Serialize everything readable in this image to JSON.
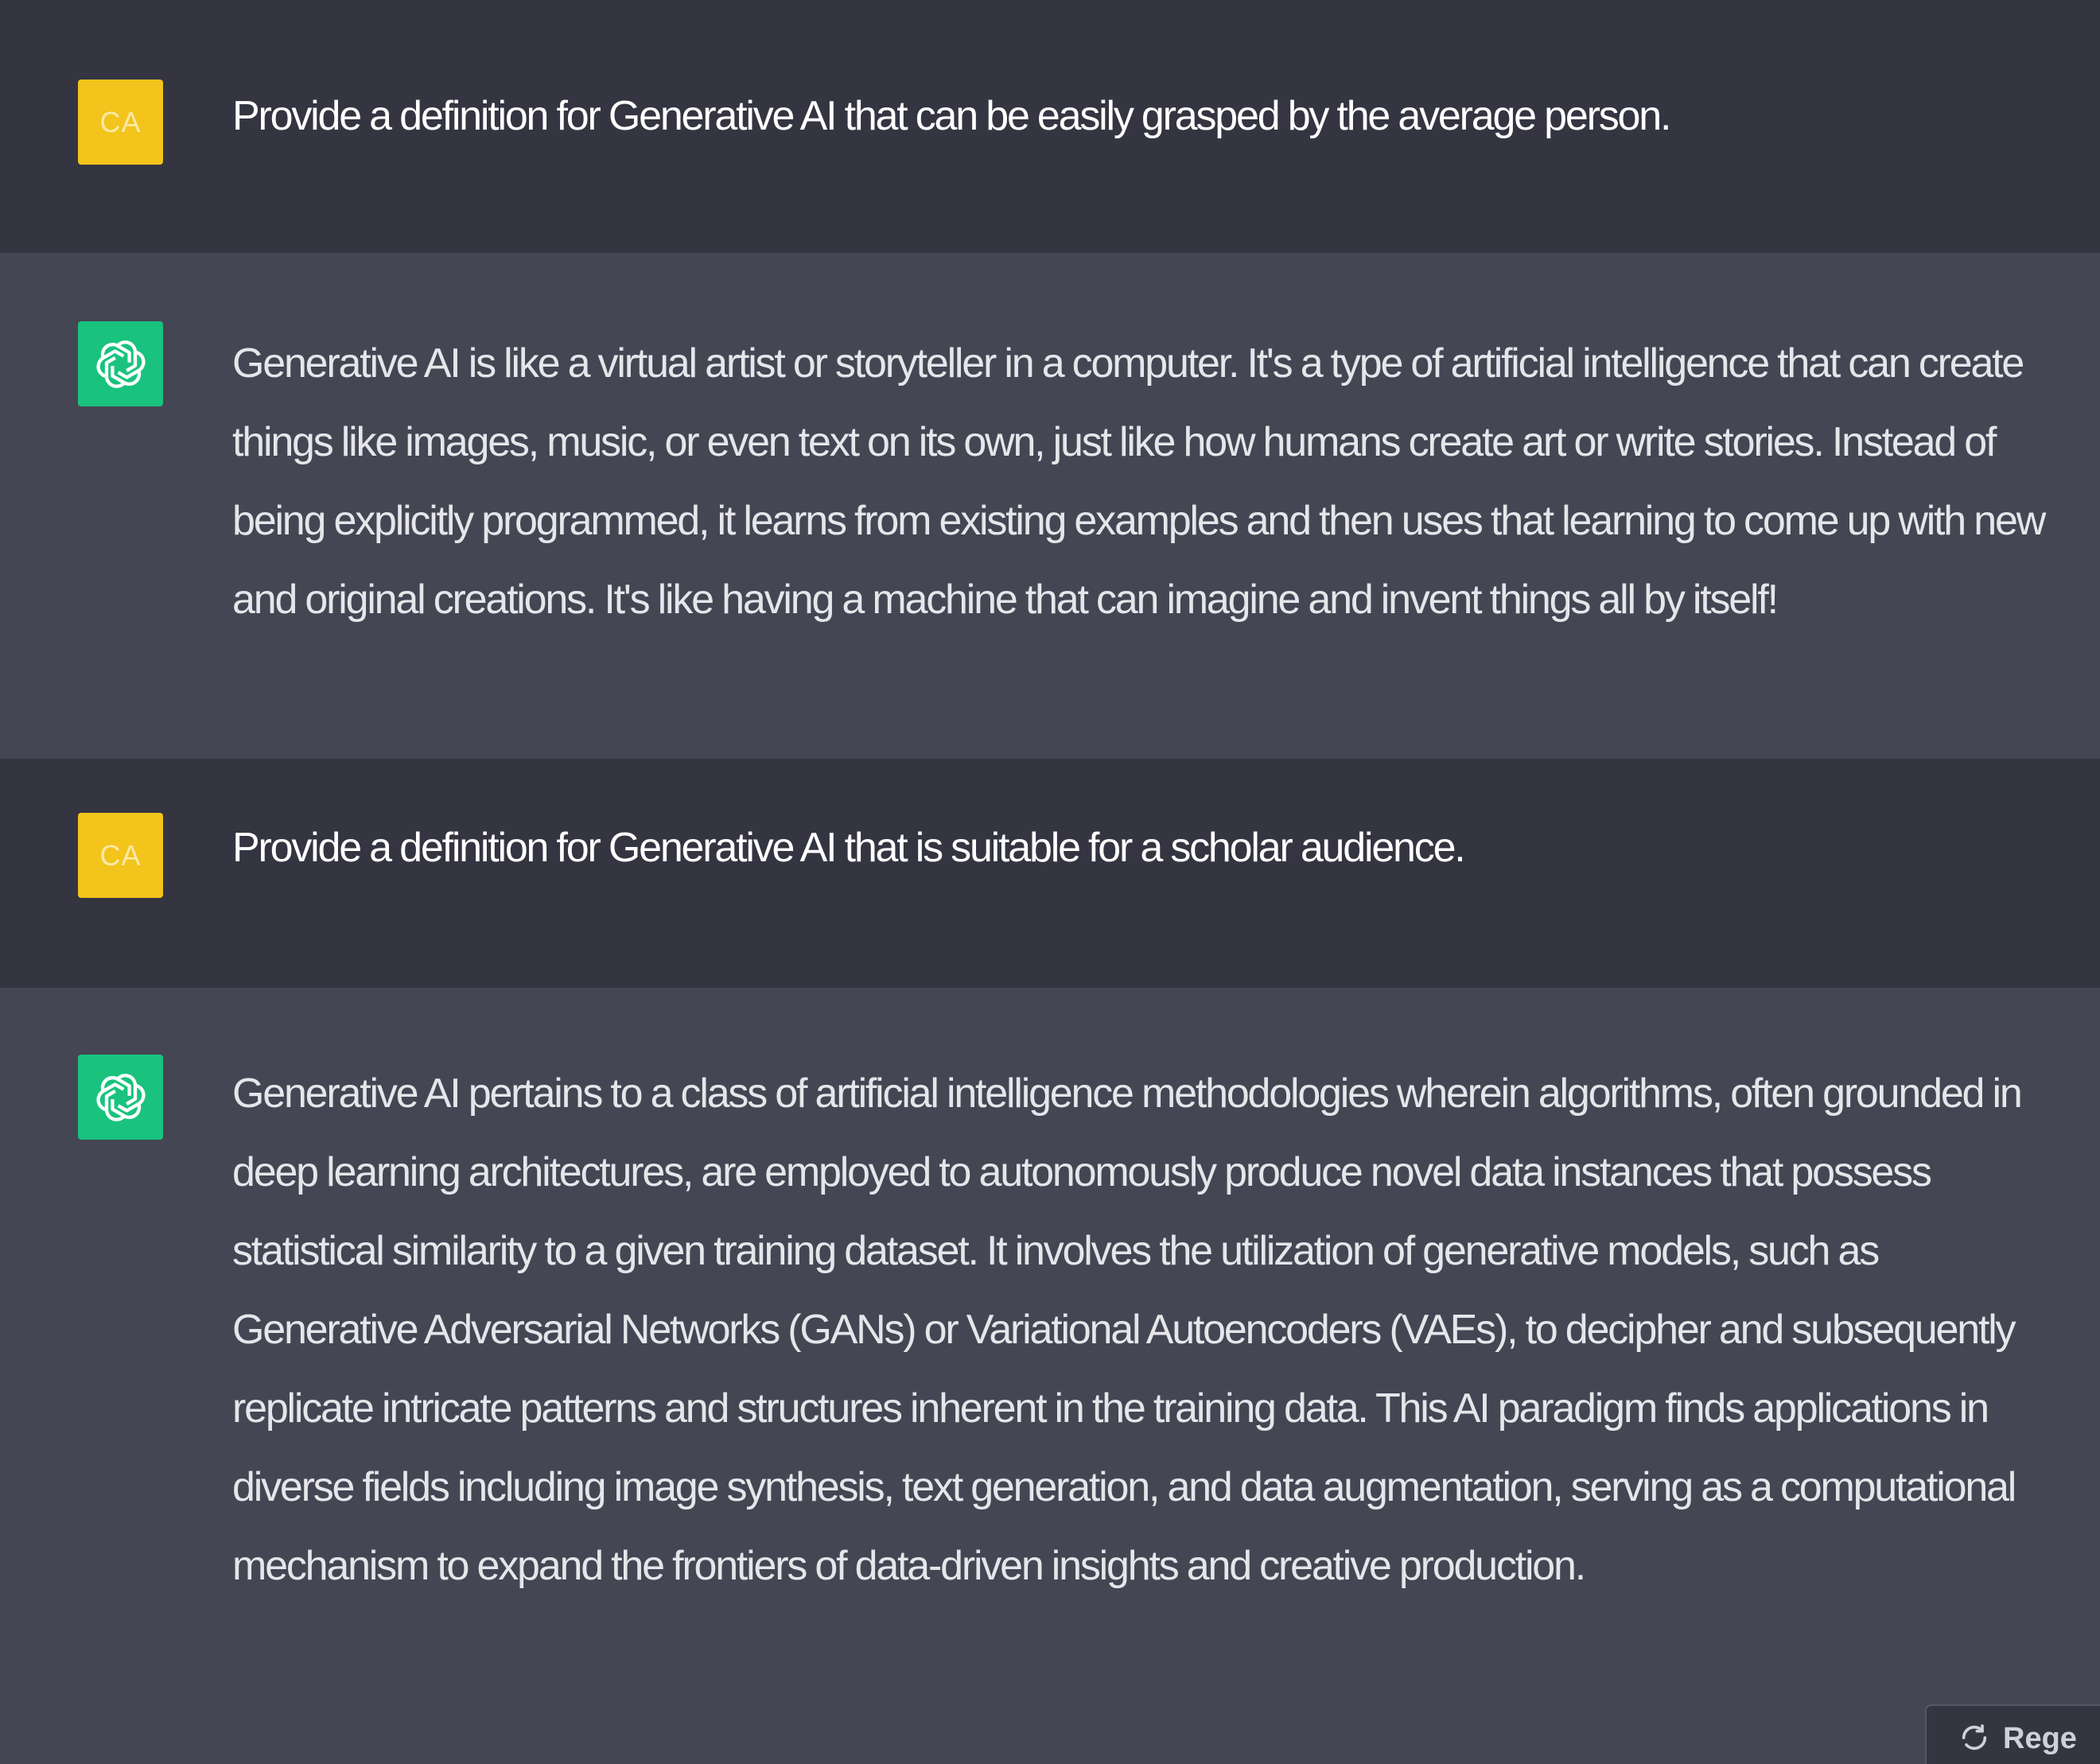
{
  "conversation": {
    "messages": [
      {
        "role": "user",
        "avatar": "CA",
        "text": "Provide a definition for Generative AI that can be easily grasped by the average person."
      },
      {
        "role": "assistant",
        "avatar_icon": "openai-logo-icon",
        "text": "Generative AI is like a virtual artist or storyteller in a computer. It's a type of artificial intelligence that can create things like images, music, or even text on its own, just like how humans create art or write stories. Instead of being explicitly programmed, it learns from existing examples and then uses that learning to come up with new and original creations. It's like having a machine that can imagine and invent things all by itself!"
      },
      {
        "role": "user",
        "avatar": "CA",
        "text": "Provide a definition for Generative AI that is suitable for a scholar audience."
      },
      {
        "role": "assistant",
        "avatar_icon": "openai-logo-icon",
        "text": "Generative AI pertains to a class of artificial intelligence methodologies wherein algorithms, often grounded in deep learning architectures, are employed to autonomously produce novel data instances that possess statistical similarity to a given training dataset. It involves the utilization of generative models, such as Generative Adversarial Networks (GANs) or Variational Autoencoders (VAEs), to decipher and subsequently replicate intricate patterns and structures inherent in the training data. This AI paradigm finds applications in diverse fields including image synthesis, text generation, and data augmentation, serving as a computational mechanism to expand the frontiers of data-driven insights and creative production."
      }
    ]
  },
  "regenerate_button": {
    "label": "Rege",
    "icon": "refresh-icon"
  },
  "colors": {
    "user_bg": "#343541",
    "assistant_bg": "#444654",
    "user_avatar": "#f2c41c",
    "assistant_avatar": "#19c37d"
  }
}
